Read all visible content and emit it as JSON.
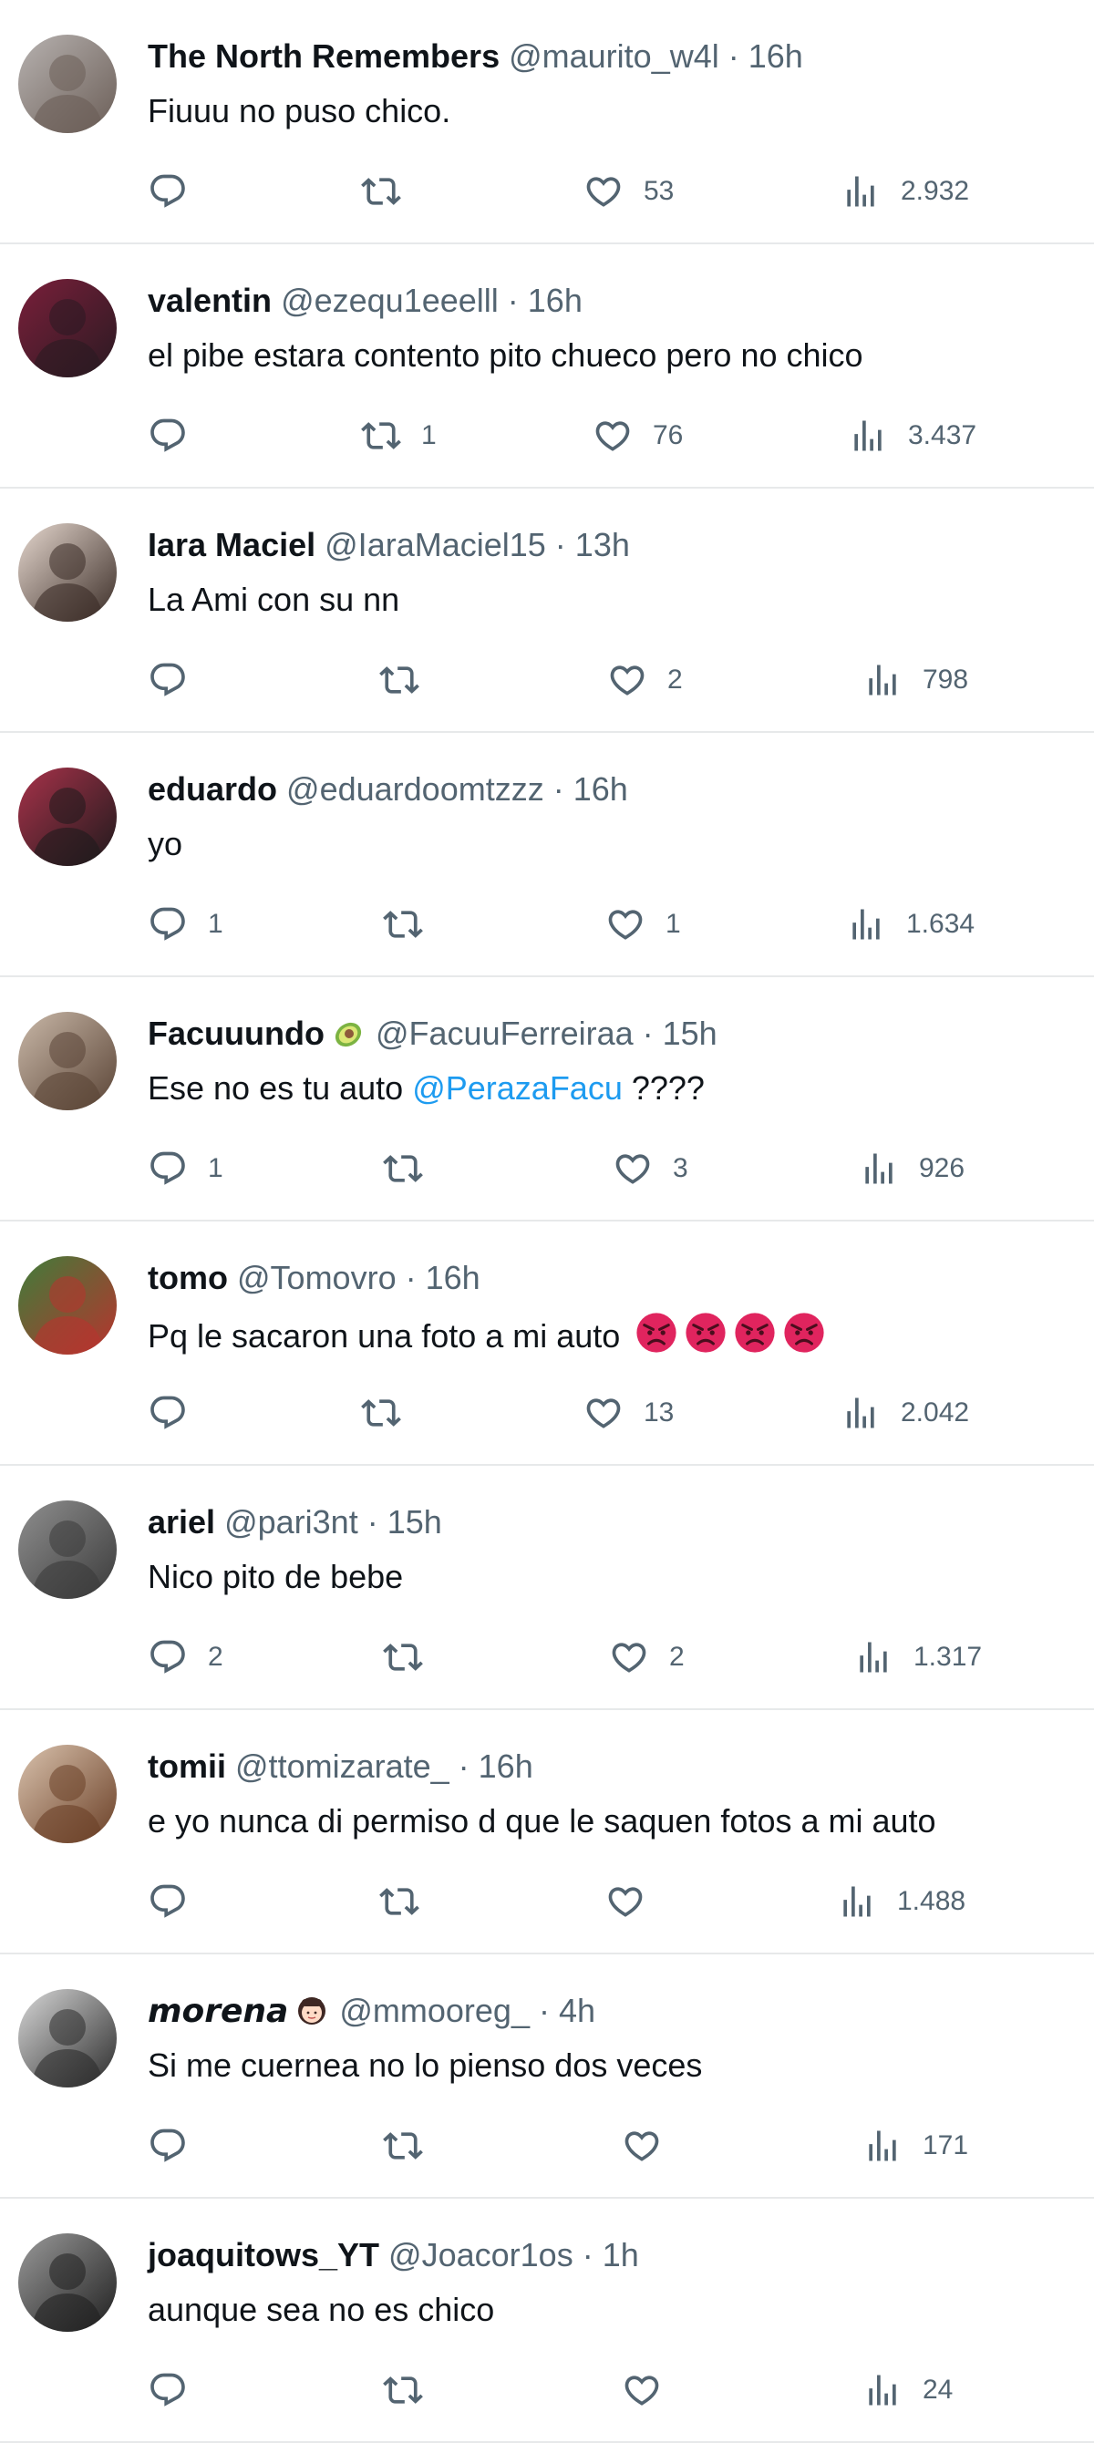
{
  "colors": {
    "text": "#0f1419",
    "muted": "#536471",
    "link": "#1d9bf0",
    "divider": "#e7e9ea",
    "angry_emoji": "#e0245e"
  },
  "replies": [
    {
      "name": "The North Remembers",
      "handle": "@maurito_w4l",
      "time": "16h",
      "text": "Fiuuu no puso chico.",
      "replies": "",
      "reposts": "",
      "likes": "53",
      "views": "2.932",
      "avatar_colors": [
        "#b7b2b0",
        "#6b5e57"
      ]
    },
    {
      "name": "valentin",
      "handle": "@ezequ1eeelll",
      "time": "16h",
      "text": "el pibe estara contento pito chueco pero no chico",
      "replies": "",
      "reposts": "1",
      "likes": "76",
      "views": "3.437",
      "avatar_colors": [
        "#7a1f3a",
        "#2a1a22"
      ]
    },
    {
      "name": "Iara Maciel",
      "handle": "@IaraMaciel15",
      "time": "13h",
      "text": "La Ami con su nn",
      "replies": "",
      "reposts": "",
      "likes": "2",
      "views": "798",
      "avatar_colors": [
        "#e6d8cf",
        "#3a2c26"
      ]
    },
    {
      "name": "eduardo",
      "handle": "@eduardoomtzzz",
      "time": "16h",
      "text": "yo",
      "replies": "1",
      "reposts": "",
      "likes": "1",
      "views": "1.634",
      "avatar_colors": [
        "#a8324a",
        "#1e1a1c"
      ]
    },
    {
      "name": "Facuuundo",
      "name_emoji": "avocado",
      "handle": "@FacuuFerreiraa",
      "time": "15h",
      "text_before": "Ese no es tu auto ",
      "mention": "@PerazaFacu",
      "text_after": " ????",
      "replies": "1",
      "reposts": "",
      "likes": "3",
      "views": "926",
      "avatar_colors": [
        "#c9b8a8",
        "#5a4436"
      ]
    },
    {
      "name": "tomo",
      "handle": "@Tomovro",
      "time": "16h",
      "text": "Pq le sacaron una foto a mi auto",
      "text_emojis": [
        "angry-face",
        "angry-face",
        "angry-face",
        "angry-face"
      ],
      "replies": "",
      "reposts": "",
      "likes": "13",
      "views": "2.042",
      "avatar_colors": [
        "#3f7d3a",
        "#b8332e"
      ]
    },
    {
      "name": "ariel",
      "handle": "@pari3nt",
      "time": "15h",
      "text": "Nico pito de bebe",
      "replies": "2",
      "reposts": "",
      "likes": "2",
      "views": "1.317",
      "avatar_colors": [
        "#8f8f8f",
        "#3b3b3b"
      ]
    },
    {
      "name": "tomii",
      "handle": "@ttomizarate_",
      "time": "16h",
      "text": "e yo nunca di permiso d que le saquen fotos a mi auto",
      "replies": "",
      "reposts": "",
      "likes": "",
      "views": "1.488",
      "avatar_colors": [
        "#d9c2ad",
        "#6a3f26"
      ]
    },
    {
      "name": "𝙢𝙤𝙧𝙚𝙣𝙖",
      "name_emoji": "woman-face",
      "handle": "@mmooreg_",
      "time": "4h",
      "text": "Si me cuernea no lo pienso dos veces",
      "replies": "",
      "reposts": "",
      "likes": "",
      "views": "171",
      "avatar_colors": [
        "#d8d8d8",
        "#2b2b2b"
      ]
    },
    {
      "name": "joaquitows_YT",
      "handle": "@Joacor1os",
      "time": "1h",
      "text": "aunque sea no es chico",
      "replies": "",
      "reposts": "",
      "likes": "",
      "views": "24",
      "avatar_colors": [
        "#9a9a9a",
        "#1f1f1f"
      ]
    }
  ]
}
